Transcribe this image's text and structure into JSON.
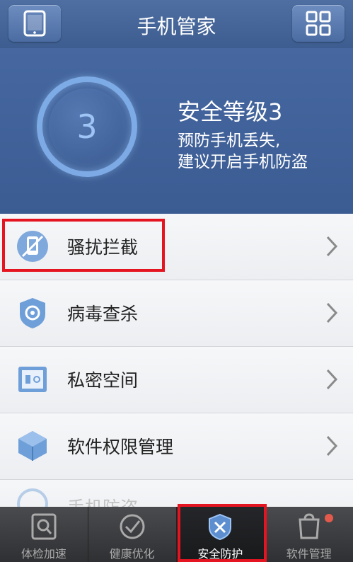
{
  "header": {
    "title": "手机管家",
    "left_icon": "phone-icon",
    "right_icon": "grid-icon"
  },
  "status": {
    "level_number": "3",
    "level_text": "安全等级3",
    "advice_line1": "预防手机丢失,",
    "advice_line2": "建议开启手机防盗"
  },
  "list": {
    "items": [
      {
        "label": "骚扰拦截",
        "icon": "harassment-block-icon"
      },
      {
        "label": "病毒查杀",
        "icon": "virus-scan-icon"
      },
      {
        "label": "私密空间",
        "icon": "private-space-icon"
      },
      {
        "label": "软件权限管理",
        "icon": "app-permission-icon"
      },
      {
        "label": "手机防盗",
        "icon": "anti-theft-icon"
      }
    ]
  },
  "nav": {
    "tabs": [
      {
        "label": "体检加速",
        "icon": "checkup-icon"
      },
      {
        "label": "健康优化",
        "icon": "optimize-icon"
      },
      {
        "label": "安全防护",
        "icon": "shield-icon"
      },
      {
        "label": "软件管理",
        "icon": "app-manage-icon"
      }
    ],
    "active": "安全防护"
  },
  "colors": {
    "accent": "#3d5d91",
    "highlight": "#e51421"
  }
}
